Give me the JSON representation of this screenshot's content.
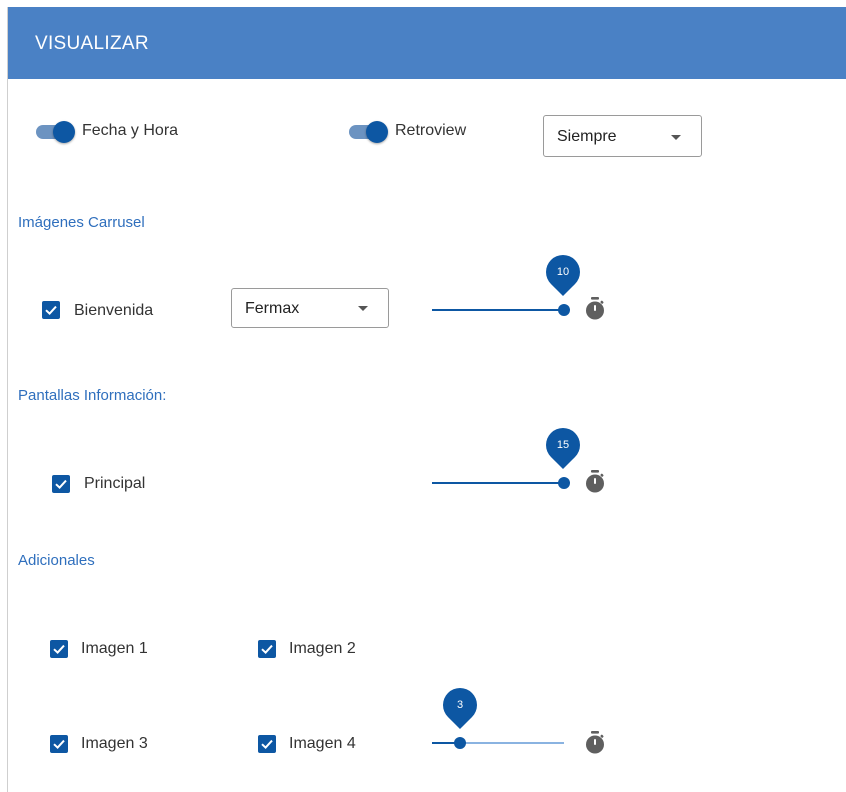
{
  "header": {
    "title": "VISUALIZAR"
  },
  "general": {
    "date_time_toggle": {
      "label": "Fecha y Hora",
      "on": true
    },
    "retroview_toggle": {
      "label": "Retroview",
      "on": true
    },
    "retroview_mode": {
      "value": "Siempre"
    }
  },
  "carousel": {
    "title": "Imágenes Carrusel",
    "welcome_checkbox": {
      "label": "Bienvenida",
      "checked": true
    },
    "welcome_source": {
      "value": "Fermax"
    },
    "welcome_time": {
      "value": "10"
    },
    "timer_icon": "stopwatch-icon"
  },
  "info_screens": {
    "title": "Pantallas Información:",
    "main_checkbox": {
      "label": "Principal",
      "checked": true
    },
    "main_time": {
      "value": "15"
    }
  },
  "additional": {
    "title": "Adicionales",
    "images": [
      {
        "label": "Imagen 1",
        "checked": true
      },
      {
        "label": "Imagen 2",
        "checked": true
      },
      {
        "label": "Imagen 3",
        "checked": true
      },
      {
        "label": "Imagen 4",
        "checked": true
      }
    ],
    "time": {
      "value": "3"
    }
  },
  "colors": {
    "header": "#4a81c5",
    "accent": "#0d57a3",
    "section_title": "#2f6fbd"
  }
}
